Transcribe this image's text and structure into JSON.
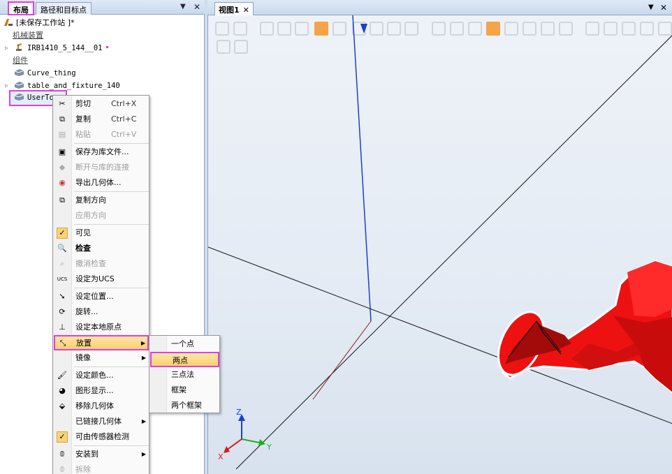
{
  "left_tabs": {
    "layout": "布局",
    "paths": "路径和目标点"
  },
  "tree": {
    "station": "[未保存工作站 ]*",
    "mechanisms_label": "机械装置",
    "robot": "IRB1410_5_144__01",
    "components_label": "组件",
    "curve": "Curve_thing",
    "table": "table_and_fixture_140",
    "usertool": "UserTo"
  },
  "context_menu": [
    {
      "label": "剪切",
      "shortcut": "Ctrl+X",
      "icon": "scissors-icon"
    },
    {
      "label": "复制",
      "shortcut": "Ctrl+C",
      "icon": "copy-icon"
    },
    {
      "label": "粘贴",
      "shortcut": "Ctrl+V",
      "icon": "paste-icon",
      "disabled": true
    },
    {
      "label": "保存为库文件...",
      "icon": "save-library-icon"
    },
    {
      "label": "断开与库的连接",
      "icon": "disconnect-library-icon",
      "disabled": true
    },
    {
      "label": "导出几何体...",
      "icon": "export-geometry-icon"
    },
    {
      "label": "复制方向",
      "icon": "copy-orientation-icon"
    },
    {
      "label": "应用方向",
      "icon": "apply-orientation-icon",
      "disabled": true
    },
    {
      "label": "可见",
      "icon": "check-icon"
    },
    {
      "label": "检查",
      "icon": "inspect-icon",
      "bold": true
    },
    {
      "label": "撤消检查",
      "icon": "undo-inspect-icon",
      "disabled": true
    },
    {
      "label": "设定为UCS",
      "icon": "ucs-icon"
    },
    {
      "label": "设定位置...",
      "icon": "set-position-icon"
    },
    {
      "label": "旋转...",
      "icon": "rotate-icon"
    },
    {
      "label": "设定本地原点",
      "icon": "local-origin-icon"
    },
    {
      "label": "放置",
      "icon": "place-icon",
      "submenu": true
    },
    {
      "label": "镜像",
      "submenu": true
    },
    {
      "label": "设定颜色...",
      "icon": "paint-brush-icon"
    },
    {
      "label": "图形显示...",
      "icon": "graphics-display-icon"
    },
    {
      "label": "移除几何体",
      "icon": "remove-geometry-icon"
    },
    {
      "label": "已链接几何体",
      "submenu": true
    },
    {
      "label": "可由传感器检测",
      "icon": "check-icon"
    },
    {
      "label": "安装到",
      "icon": "attach-icon",
      "submenu": true
    },
    {
      "label": "拆除",
      "icon": "detach-icon",
      "disabled": true
    }
  ],
  "place_submenu": [
    "一个点",
    "两点",
    "三点法",
    "框架",
    "两个框架"
  ],
  "view": {
    "tab_label": "视图1",
    "close_glyph": "✕"
  },
  "axes": {
    "x": "X",
    "y": "Y",
    "z": "Z"
  }
}
